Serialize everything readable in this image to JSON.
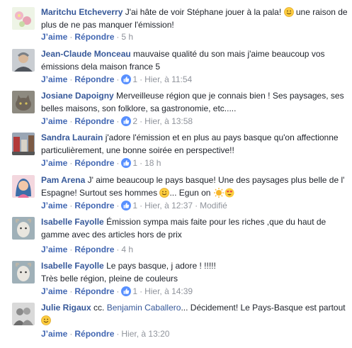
{
  "actions": {
    "like": "J’aime",
    "reply": "Répondre",
    "sep": "·"
  },
  "comments": [
    {
      "author": "Maritchu Etcheverry",
      "text1": "J'ai hâte de voir Stéphane jouer à la pala!",
      "text2": "une raison de plus de ne pas manquer l'émission!",
      "time": "5 h",
      "avatar": "flowers-avatar"
    },
    {
      "author": "Jean-Claude Monceau",
      "text": "mauvaise qualité du son mais j'aime beaucoup vos émissions dela maison france 5",
      "likes": "1",
      "time": "Hier, à 11:54",
      "avatar": "man-avatar"
    },
    {
      "author": "Josiane Dapoigny",
      "text": "Merveilleuse région que je connais bien ! Ses paysages, ses belles maisons, son folklore, sa gastronomie, etc.....",
      "likes": "2",
      "time": "Hier, à 13:58",
      "avatar": "cat-avatar"
    },
    {
      "author": "Sandra Laurain",
      "text": "j'adore l'émission et en plus au pays basque qu'on affectionne particulièrement, une bonne soirée en perspective!!",
      "likes": "1",
      "time": "18 h",
      "avatar": "street-avatar"
    },
    {
      "author": "Pam Arena",
      "text1": "J' aime beaucoup le pays basque! Une des paysages plus belle de l' Espagne! Surtout ses hommes",
      "text2": "... Egun on",
      "likes": "1",
      "time": "Hier, à 12:37",
      "edited": "Modifié",
      "avatar": "woman-avatar"
    },
    {
      "author": "Isabelle Fayolle",
      "text": "Émission sympa mais faite pour les riches ,que du haut de gamme avec des articles hors de prix",
      "time": "4 h",
      "avatar": "goat-avatar"
    },
    {
      "author": "Isabelle Fayolle",
      "text": "Le pays basque, j adore ! !!!!!",
      "text_line2": "Très belle région, pleine de couleurs",
      "likes": "1",
      "time": "Hier, à 14:39",
      "avatar": "goat-avatar"
    },
    {
      "author": "Julie Rigaux",
      "text_before": "cc.",
      "mention": "Benjamin Caballero",
      "text_after": "... Décidement! Le Pays-Basque est partout",
      "time": "Hier, à 13:20",
      "avatar": "people-avatar"
    }
  ]
}
